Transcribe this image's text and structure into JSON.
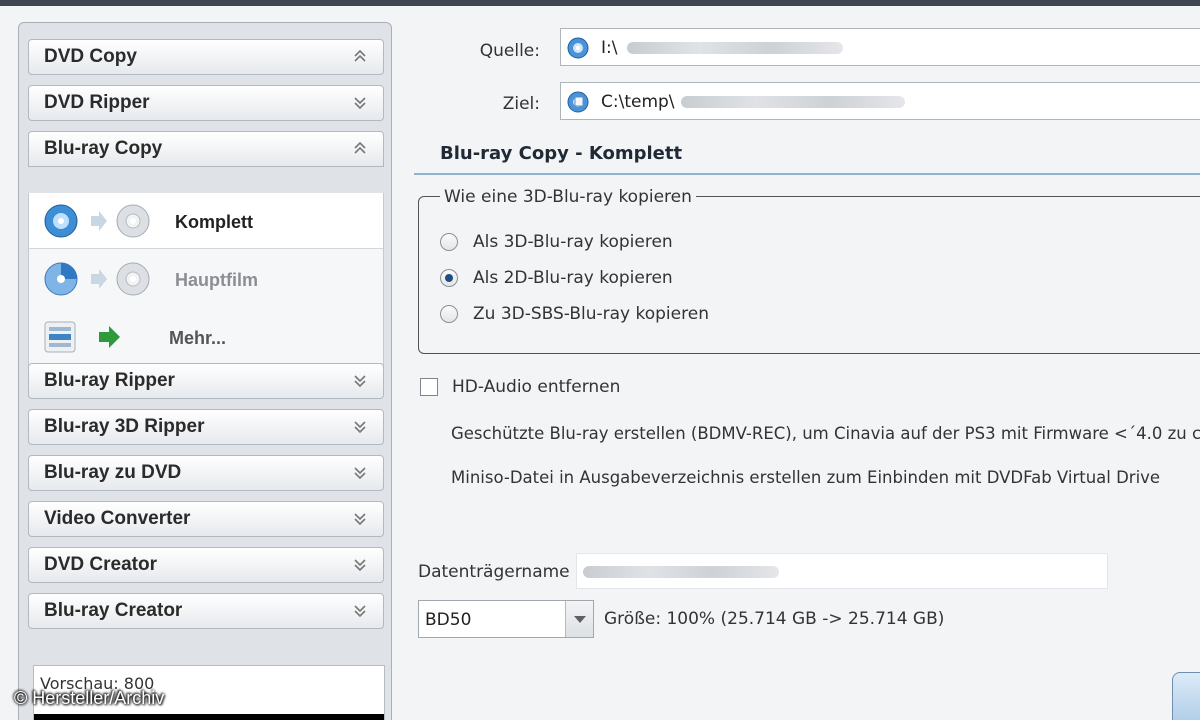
{
  "sidebar": {
    "sections": [
      {
        "label": "DVD Copy",
        "chevron": "chevron-up"
      },
      {
        "label": "DVD Ripper",
        "chevron": "chevron-down"
      },
      {
        "label": "Blu-ray Copy",
        "chevron": "chevron-up"
      },
      {
        "label": "Blu-ray Ripper",
        "chevron": "chevron-down"
      },
      {
        "label": "Blu-ray 3D Ripper",
        "chevron": "chevron-down"
      },
      {
        "label": "Blu-ray zu DVD",
        "chevron": "chevron-down"
      },
      {
        "label": "Video Converter",
        "chevron": "chevron-down"
      },
      {
        "label": "DVD Creator",
        "chevron": "chevron-down"
      },
      {
        "label": "Blu-ray Creator",
        "chevron": "chevron-down"
      }
    ],
    "bluray_copy_options": [
      {
        "label": "Komplett",
        "icon": "full-disc-copy-icon",
        "selected": true
      },
      {
        "label": "Hauptfilm",
        "icon": "main-movie-copy-icon",
        "selected": false
      },
      {
        "label": "Mehr...",
        "icon": "more-options-icon",
        "selected": false
      }
    ],
    "preview_label": "Vorschau: 800"
  },
  "source": {
    "label": "Quelle:",
    "path": "I:\\"
  },
  "target": {
    "label": "Ziel:",
    "path": "C:\\temp\\"
  },
  "mode_title": "Blu-ray Copy  -  Komplett",
  "group3d": {
    "legend": "Wie eine 3D-Blu-ray kopieren",
    "options": [
      {
        "label": "Als 3D-Blu-ray kopieren",
        "selected": false
      },
      {
        "label": "Als 2D-Blu-ray kopieren",
        "selected": true
      },
      {
        "label": "Zu 3D-SBS-Blu-ray kopieren",
        "selected": false
      }
    ]
  },
  "hd_audio": {
    "label": "HD-Audio entfernen",
    "checked": false
  },
  "info_lines": [
    "Geschützte Blu-ray erstellen (BDMV-REC), um Cinavia auf der PS3 mit Firmware <´4.0 zu c",
    "Miniso-Datei in Ausgabeverzeichnis erstellen zum Einbinden mit DVDFab Virtual Drive"
  ],
  "disk_name_label": "Datenträgername",
  "disk_type": {
    "value": "BD50"
  },
  "size_text": "Größe: 100% (25.714 GB -> 25.714 GB)",
  "credit": "© Hersteller/Archiv",
  "colors": {
    "accent": "#8fb4d3",
    "radio_selected": "#1f4f80",
    "action_arrow": "#2f9a3a"
  }
}
